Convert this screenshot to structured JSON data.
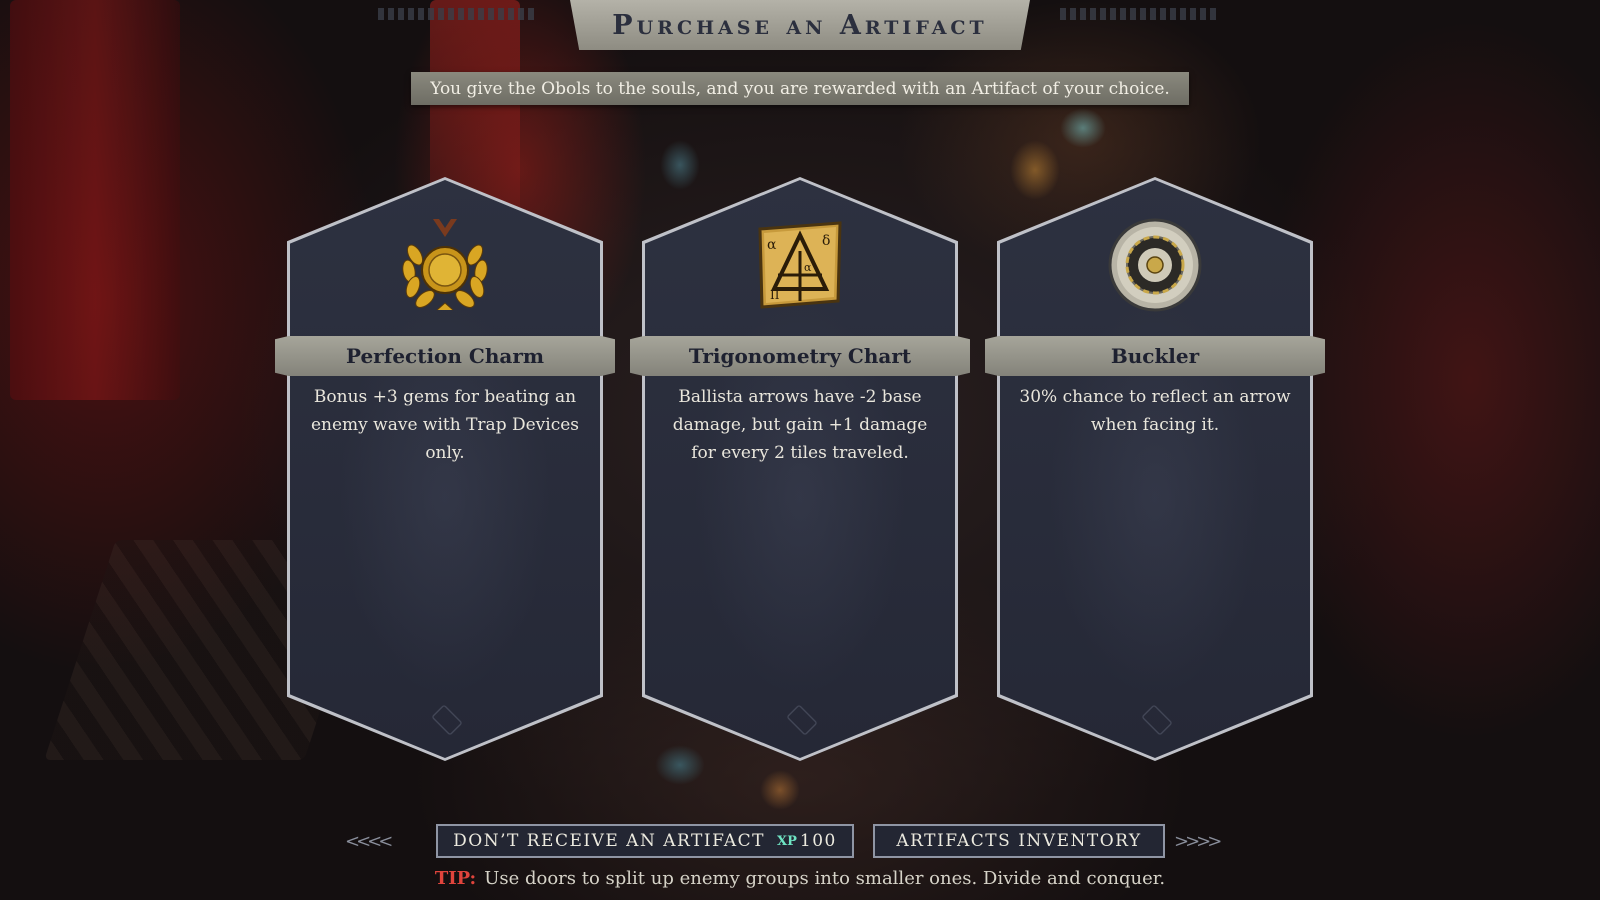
{
  "title": "Purchase an Artifact",
  "subtitle": "You give the Obols to the souls, and you are rewarded with an Artifact of your choice.",
  "cards": [
    {
      "name": "Perfection Charm",
      "description": "Bonus +3 gems for beating an enemy wave with Trap Devices only.",
      "icon": "laurel-medal-icon"
    },
    {
      "name": "Trigonometry Chart",
      "description": "Ballista arrows have -2 base damage, but gain +1 damage for every 2 tiles traveled.",
      "icon": "parchment-chart-icon"
    },
    {
      "name": "Buckler",
      "description": "30% chance to reflect an arrow when facing it.",
      "icon": "round-shield-icon"
    }
  ],
  "buttons": {
    "decline_label": "DON’T RECEIVE AN ARTIFACT",
    "decline_xp_symbol": "XP",
    "decline_xp_value": "100",
    "inventory_label": "ARTIFACTS INVENTORY"
  },
  "tip": {
    "label": "TIP:",
    "text": "Use doors to split up enemy groups into smaller ones. Divide and conquer."
  },
  "colors": {
    "accent_xp": "#6fe3c3",
    "tip_label": "#e0443c",
    "card_bg": "#2d3140",
    "banner": "#a6a59a"
  }
}
